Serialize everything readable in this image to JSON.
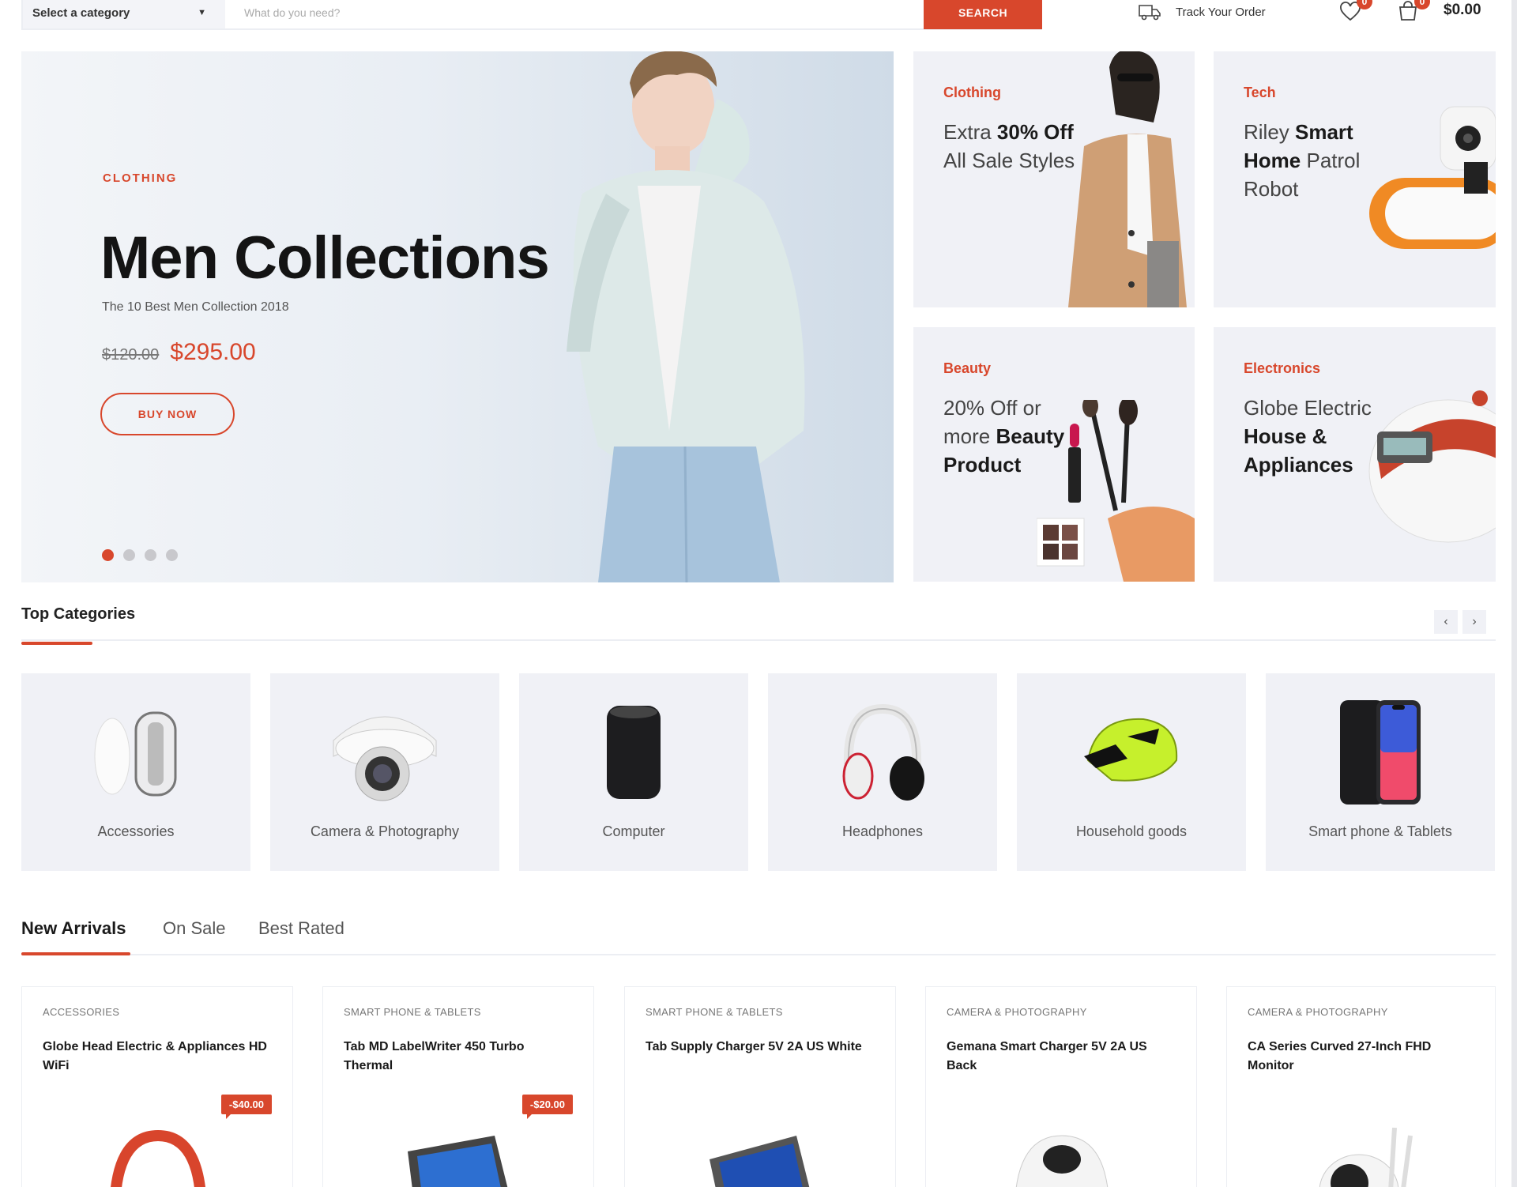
{
  "header": {
    "category_select": "Select a category",
    "search_placeholder": "What do you need?",
    "search_button": "SEARCH",
    "track_order": "Track Your Order",
    "wishlist_count": "0",
    "cart_count": "0",
    "cart_total": "$0.00"
  },
  "hero": {
    "eyebrow": "CLOTHING",
    "title": "Men Collections",
    "subtitle": "The 10 Best Men Collection 2018",
    "old_price": "$120.00",
    "new_price": "$295.00",
    "button": "BUY NOW",
    "slide_count": 4,
    "active_slide": 1
  },
  "promos": [
    {
      "category": "Clothing",
      "text_pre": "Extra ",
      "text_bold": "30% Off",
      "text_post": " All Sale Styles"
    },
    {
      "category": "Tech",
      "text_pre": "Riley ",
      "text_bold": "Smart Home",
      "text_post": " Patrol Robot"
    },
    {
      "category": "Beauty",
      "text_pre": "20% Off or more ",
      "text_bold": "Beauty Product",
      "text_post": ""
    },
    {
      "category": "Electronics",
      "text_pre": "Globe Electric ",
      "text_bold": "House & Appliances",
      "text_post": ""
    }
  ],
  "top_categories": {
    "title": "Top Categories",
    "prev": "‹",
    "next": "›",
    "items": [
      {
        "label": "Accessories"
      },
      {
        "label": "Camera & Photography"
      },
      {
        "label": "Computer"
      },
      {
        "label": "Headphones"
      },
      {
        "label": "Household goods"
      },
      {
        "label": "Smart phone & Tablets"
      }
    ]
  },
  "tabs": [
    {
      "label": "New Arrivals",
      "active": true
    },
    {
      "label": "On Sale",
      "active": false
    },
    {
      "label": "Best Rated",
      "active": false
    }
  ],
  "products": [
    {
      "category": "ACCESSORIES",
      "name": "Globe Head Electric & Appliances HD WiFi",
      "discount": "-$40.00"
    },
    {
      "category": "SMART PHONE & TABLETS",
      "name": "Tab MD LabelWriter 450 Turbo Thermal",
      "discount": "-$20.00"
    },
    {
      "category": "SMART PHONE & TABLETS",
      "name": "Tab Supply Charger 5V 2A US White",
      "discount": ""
    },
    {
      "category": "CAMERA & PHOTOGRAPHY",
      "name": "Gemana Smart Charger 5V 2A US Back",
      "discount": ""
    },
    {
      "category": "CAMERA & PHOTOGRAPHY",
      "name": "CA Series Curved 27-Inch FHD Monitor",
      "discount": ""
    }
  ],
  "colors": {
    "accent": "#d8472c",
    "tile_bg": "#f0f1f6",
    "text_dark": "#1a1a1a"
  }
}
